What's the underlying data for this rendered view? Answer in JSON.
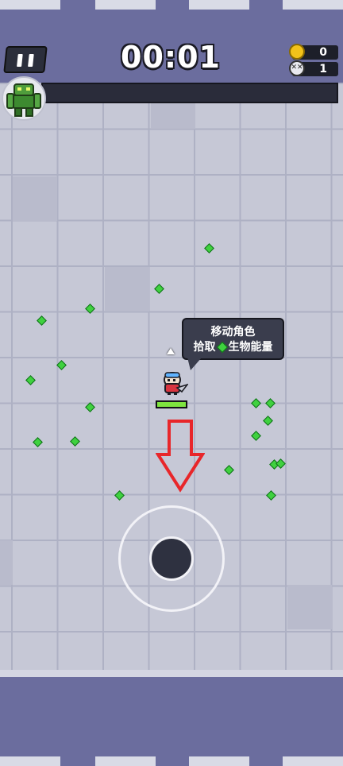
{
  "hud": {
    "timer": "00:01",
    "coins": "0",
    "kills": "1",
    "coin_icon": "coin-icon",
    "kill_icon": "skull-icon",
    "pause_icon": "pause-icon"
  },
  "experience": {
    "level_progress": 0
  },
  "player": {
    "health_fraction": 0.95
  },
  "tutorial": {
    "line1": "移动角色",
    "line2_prefix": "拾取",
    "line2_suffix": "生物能量",
    "arrow_direction": "down"
  },
  "colors": {
    "gem": "#3fd13f",
    "health": "#7ee53f",
    "arrow": "#e8262a",
    "background": "#6b6d9e"
  }
}
